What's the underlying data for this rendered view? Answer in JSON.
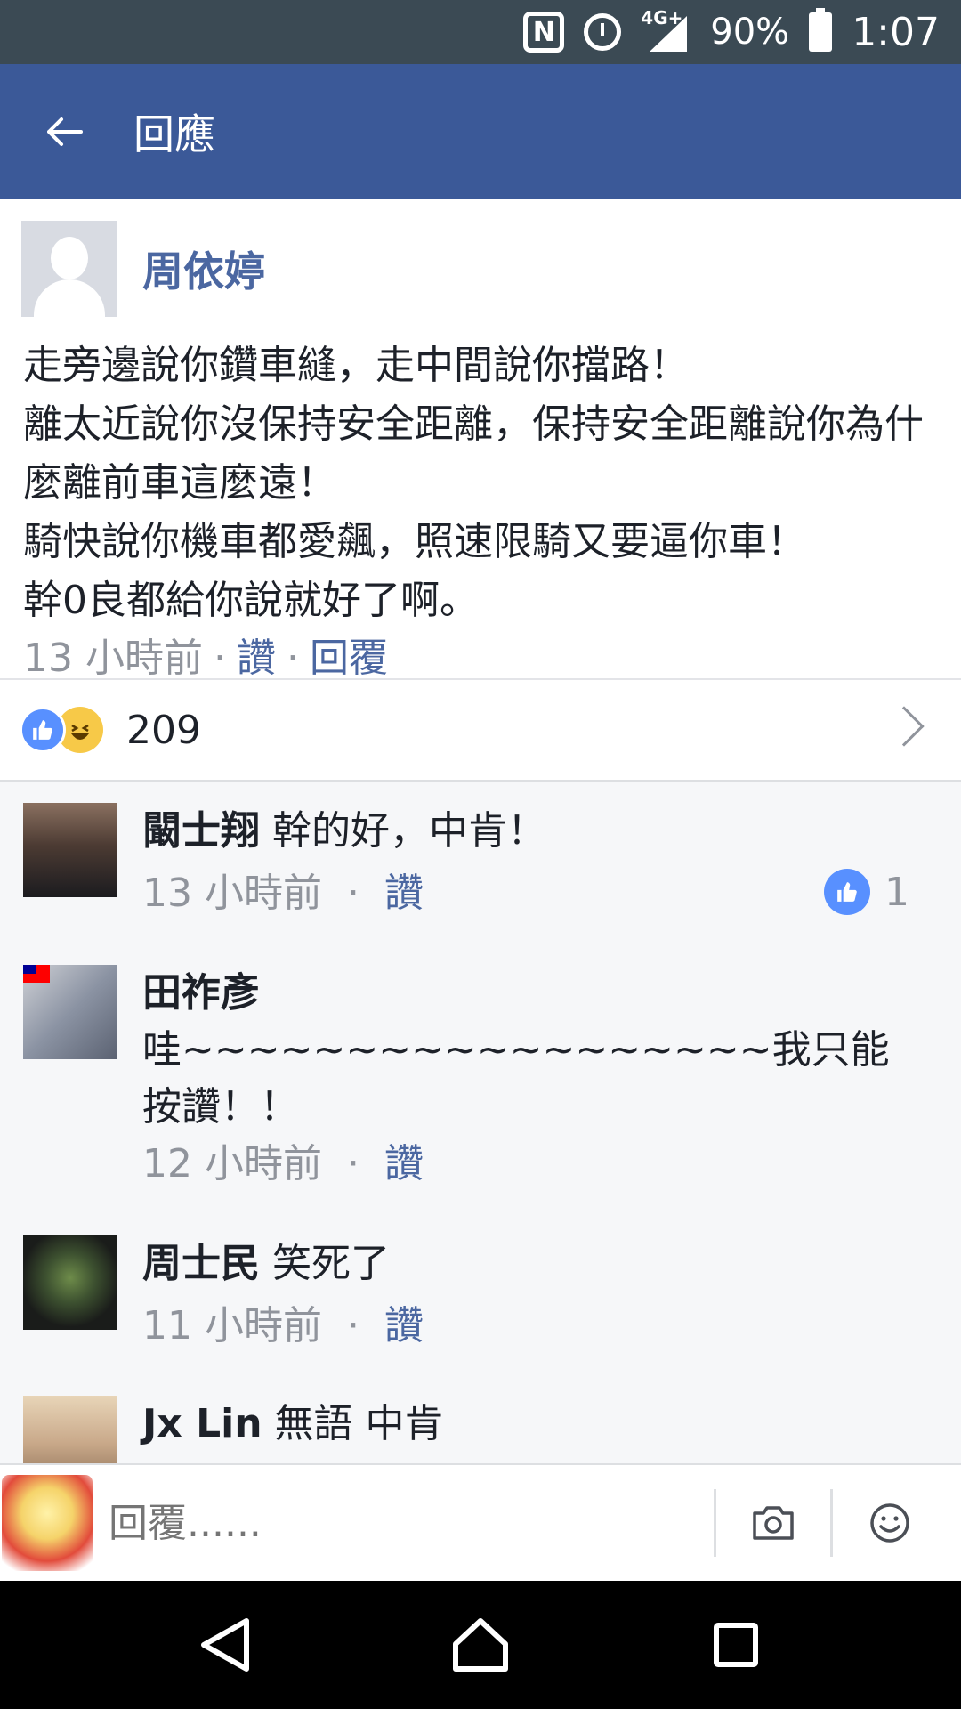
{
  "status_bar": {
    "network": "4G+",
    "battery": "90%",
    "time": "1:07"
  },
  "app_bar": {
    "title": "回應"
  },
  "post": {
    "author": "周依婷",
    "text": "走旁邊說你鑽車縫，走中間說你擋路！\n離太近說你沒保持安全距離，保持安全距離說你為什麼離前車這麼遠！\n騎快說你機車都愛飆，照速限騎又要逼你車！\n幹0良都給你說就好了啊。",
    "time": "13 小時前",
    "like_label": "讚",
    "reply_label": "回覆",
    "reaction_count": "209"
  },
  "comments": [
    {
      "name": "闞士翔",
      "text": "幹的好，中肯！",
      "time": "13 小時前",
      "like_label": "讚",
      "likes": "1",
      "avatar": "photo-man-suit"
    },
    {
      "name": "田祚彥",
      "text": "哇~~~~~~~~~~~~~~~~~~我只能按讚！！",
      "time": "12 小時前",
      "like_label": "讚",
      "avatar": "game-character-with-flag"
    },
    {
      "name": "周士民",
      "text": "笑死了",
      "time": "11 小時前",
      "like_label": "讚",
      "avatar": "frog-hoodie"
    },
    {
      "name": "Jx Lin",
      "text": "無語 中肯",
      "avatar": "man-sunset"
    }
  ],
  "composer": {
    "placeholder": "回覆......"
  },
  "colors": {
    "brand": "#3b5998",
    "link": "#4b67a1",
    "like": "#5890ff",
    "meta": "#90949c"
  }
}
